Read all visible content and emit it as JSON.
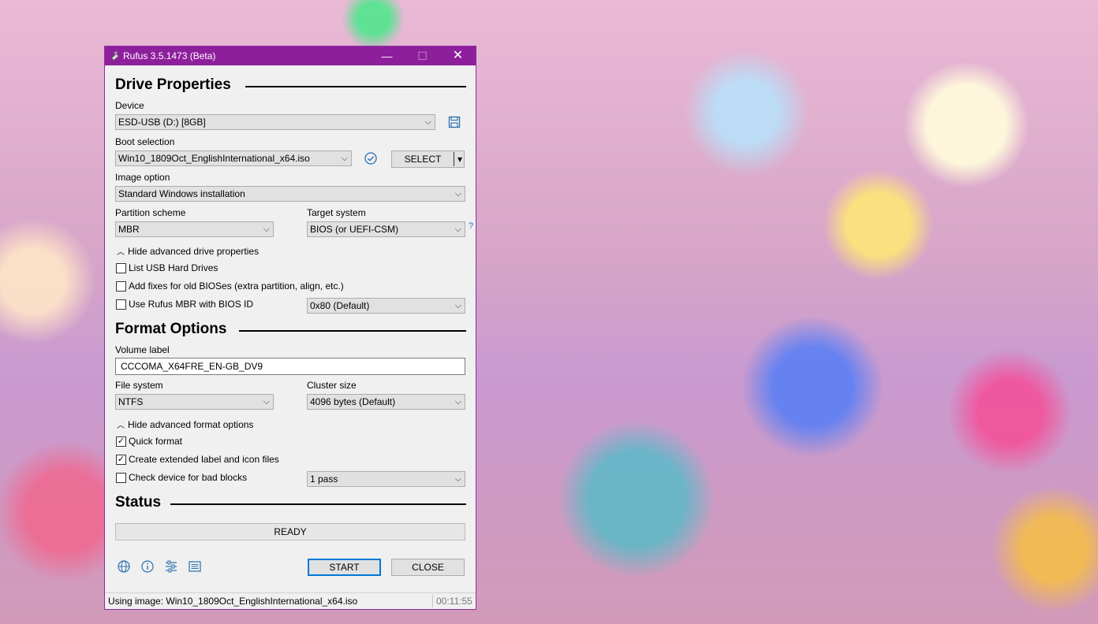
{
  "window": {
    "title": "Rufus 3.5.1473 (Beta)",
    "controls": {
      "minimize": "—",
      "maximize": "☐",
      "close": "✕"
    }
  },
  "colors": {
    "titlebar": "#8e1f9c",
    "default_button_border": "#0078d7",
    "progress_fill": "#06b025"
  },
  "drive_properties": {
    "heading": "Drive Properties",
    "device_label": "Device",
    "device_value": "ESD-USB (D:) [8GB]",
    "save_icon": "save-icon",
    "boot_selection_label": "Boot selection",
    "boot_selection_value": "Win10_1809Oct_EnglishInternational_x64.iso",
    "verify_icon": "check-circle-icon",
    "select_button": "SELECT",
    "select_arrow": "▾",
    "image_option_label": "Image option",
    "image_option_value": "Standard Windows installation",
    "partition_scheme_label": "Partition scheme",
    "partition_scheme_value": "MBR",
    "target_system_label": "Target system",
    "target_system_value": "BIOS (or UEFI-CSM)",
    "help_mark": "?",
    "advanced_toggle": "Hide advanced drive properties",
    "list_usb_hdd": {
      "label": "List USB Hard Drives",
      "checked": false
    },
    "old_bios_fixes": {
      "label": "Add fixes for old BIOSes (extra partition, align, etc.)",
      "checked": false
    },
    "rufus_mbr": {
      "label": "Use Rufus MBR with BIOS ID",
      "checked": false
    },
    "bios_id_value": "0x80 (Default)"
  },
  "format_options": {
    "heading": "Format Options",
    "volume_label_label": "Volume label",
    "volume_label_value": "CCCOMA_X64FRE_EN-GB_DV9",
    "file_system_label": "File system",
    "file_system_value": "NTFS",
    "cluster_size_label": "Cluster size",
    "cluster_size_value": "4096 bytes (Default)",
    "advanced_toggle": "Hide advanced format options",
    "quick_format": {
      "label": "Quick format",
      "checked": true
    },
    "extended_label": {
      "label": "Create extended label and icon files",
      "checked": true
    },
    "bad_blocks": {
      "label": "Check device for bad blocks",
      "checked": false
    },
    "passes_value": "1 pass"
  },
  "status": {
    "heading": "Status",
    "progress_text": "READY",
    "progress_fraction": 0,
    "start_button": "START",
    "close_button": "CLOSE",
    "tool_icons": [
      "globe-icon",
      "info-icon",
      "settings-sliders-icon",
      "log-icon"
    ]
  },
  "statusbar": {
    "message": "Using image: Win10_1809Oct_EnglishInternational_x64.iso",
    "timer": "00:11:55"
  }
}
